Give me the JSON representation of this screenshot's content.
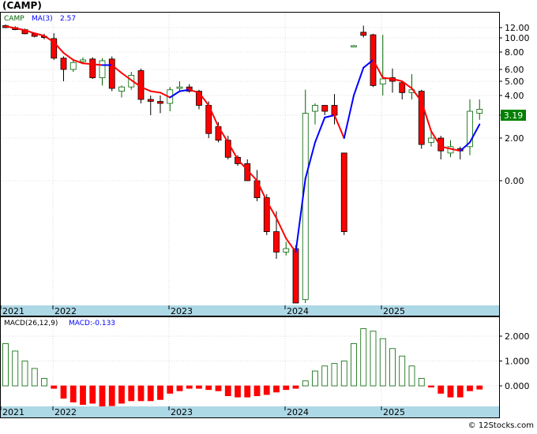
{
  "ticker": "(CAMP)",
  "watermark": "© 12Stocks.com",
  "colors": {
    "up": "#006400",
    "down": "#ff0000",
    "ma": "#0000ff",
    "axis_band": "#add8e6",
    "grid": "#c0c0c0",
    "last_price_box": "#008000"
  },
  "price_panel": {
    "legend_symbol": "CAMP",
    "ma_label": "MA(3)",
    "ma_value": "2.57",
    "last_price": "3.19",
    "y_ticks": [
      "12.00",
      "10.00",
      "8.00",
      "6.00",
      "5.00",
      "4.00",
      "3.00",
      "2.00",
      "0.00"
    ]
  },
  "macd_panel": {
    "label": "MACD(26,12,9)",
    "value_label": "MACD:-0.133",
    "y_ticks": [
      "2.000",
      "1.000",
      "0.000"
    ]
  },
  "x_axis": {
    "labels": [
      "2021",
      "2022",
      "2023",
      "2024",
      "2025"
    ]
  },
  "chart_data": [
    {
      "type": "candlestick",
      "title": "(CAMP)",
      "legend": [
        "CAMP",
        "MA(3) 2.57"
      ],
      "ylabels": [
        "12.00",
        "10.00",
        "8.00",
        "6.00",
        "5.00",
        "4.00",
        "3.00",
        "2.00",
        "0.00"
      ],
      "last_price": 3.19,
      "candles": [
        {
          "o": 12.3,
          "h": 12.5,
          "l": 11.9,
          "c": 12.0
        },
        {
          "o": 12.0,
          "h": 12.2,
          "l": 11.5,
          "c": 11.6
        },
        {
          "o": 11.6,
          "h": 11.8,
          "l": 10.7,
          "c": 10.8
        },
        {
          "o": 10.8,
          "h": 11.0,
          "l": 10.1,
          "c": 10.3
        },
        {
          "o": 10.3,
          "h": 10.8,
          "l": 9.8,
          "c": 10.1
        },
        {
          "o": 9.9,
          "h": 10.9,
          "l": 7.1,
          "c": 7.3
        },
        {
          "o": 7.3,
          "h": 7.5,
          "l": 5.0,
          "c": 6.0
        },
        {
          "o": 6.0,
          "h": 7.1,
          "l": 5.8,
          "c": 6.8
        },
        {
          "o": 6.9,
          "h": 7.4,
          "l": 6.7,
          "c": 7.1
        },
        {
          "o": 7.2,
          "h": 7.4,
          "l": 5.2,
          "c": 5.3
        },
        {
          "o": 5.3,
          "h": 7.3,
          "l": 4.7,
          "c": 7.0
        },
        {
          "o": 7.2,
          "h": 7.5,
          "l": 4.3,
          "c": 4.5
        },
        {
          "o": 4.3,
          "h": 4.7,
          "l": 3.9,
          "c": 4.6
        },
        {
          "o": 4.6,
          "h": 5.8,
          "l": 4.4,
          "c": 5.5
        },
        {
          "o": 5.9,
          "h": 6.1,
          "l": 3.6,
          "c": 3.8
        },
        {
          "o": 3.8,
          "h": 4.0,
          "l": 3.0,
          "c": 3.7
        },
        {
          "o": 3.7,
          "h": 4.0,
          "l": 3.1,
          "c": 3.6
        },
        {
          "o": 3.6,
          "h": 4.6,
          "l": 3.2,
          "c": 4.4
        },
        {
          "o": 4.5,
          "h": 5.0,
          "l": 4.3,
          "c": 4.6
        },
        {
          "o": 4.6,
          "h": 4.8,
          "l": 4.2,
          "c": 4.3
        },
        {
          "o": 4.3,
          "h": 4.4,
          "l": 3.3,
          "c": 3.5
        },
        {
          "o": 3.5,
          "h": 3.7,
          "l": 2.0,
          "c": 2.2
        },
        {
          "o": 2.5,
          "h": 2.7,
          "l": 1.8,
          "c": 1.9
        },
        {
          "o": 1.9,
          "h": 2.1,
          "l": 1.0,
          "c": 1.1
        },
        {
          "o": 1.1,
          "h": 1.2,
          "l": 0.7,
          "c": 0.8
        },
        {
          "o": 0.8,
          "h": 1.0,
          "l": 0.0,
          "c": 0.0
        },
        {
          "o": 0.0,
          "h": 0.5,
          "l": -0.6,
          "c": -0.5
        },
        {
          "o": -0.5,
          "h": -0.4,
          "l": -1.6,
          "c": -1.5
        },
        {
          "o": -1.5,
          "h": -0.9,
          "l": -2.3,
          "c": -2.1
        },
        {
          "o": -2.1,
          "h": -1.8,
          "l": -2.2,
          "c": -2.0
        },
        {
          "o": -2.0,
          "h": -1.9,
          "l": -3.6,
          "c": -3.6
        },
        {
          "o": -3.5,
          "h": 4.4,
          "l": -3.6,
          "c": 3.1
        },
        {
          "o": 3.2,
          "h": 3.6,
          "l": 2.6,
          "c": 3.5
        },
        {
          "o": 3.5,
          "h": 3.5,
          "l": 3.0,
          "c": 3.2
        },
        {
          "o": 3.5,
          "h": 4.1,
          "l": 2.6,
          "c": 3.0
        },
        {
          "o": 1.3,
          "h": 1.3,
          "l": -1.6,
          "c": -1.5
        },
        {
          "o": 8.9,
          "h": 9.0,
          "l": 8.9,
          "c": 8.9
        },
        {
          "o": 11.1,
          "h": 12.3,
          "l": 10.1,
          "c": 10.5
        },
        {
          "o": 10.6,
          "h": 10.8,
          "l": 4.6,
          "c": 4.7
        },
        {
          "o": 4.8,
          "h": 10.6,
          "l": 4.0,
          "c": 5.2
        },
        {
          "o": 5.3,
          "h": 6.1,
          "l": 4.2,
          "c": 5.0
        },
        {
          "o": 4.9,
          "h": 5.0,
          "l": 3.8,
          "c": 4.2
        },
        {
          "o": 4.2,
          "h": 5.6,
          "l": 3.8,
          "c": 4.4
        },
        {
          "o": 4.3,
          "h": 4.4,
          "l": 1.5,
          "c": 1.7
        },
        {
          "o": 1.8,
          "h": 2.3,
          "l": 1.6,
          "c": 2.0
        },
        {
          "o": 2.0,
          "h": 2.1,
          "l": 1.0,
          "c": 1.4
        },
        {
          "o": 1.3,
          "h": 1.9,
          "l": 1.1,
          "c": 1.6
        },
        {
          "o": 1.5,
          "h": 1.6,
          "l": 1.0,
          "c": 1.4
        },
        {
          "o": 1.6,
          "h": 3.8,
          "l": 1.2,
          "c": 3.2
        },
        {
          "o": 3.1,
          "h": 3.8,
          "l": 2.8,
          "c": 3.3
        }
      ],
      "ma": [
        12.2,
        11.9,
        11.5,
        10.9,
        10.4,
        9.4,
        7.9,
        7.1,
        6.7,
        6.6,
        6.5,
        6.5,
        5.7,
        5.1,
        4.6,
        4.3,
        4.2,
        3.9,
        4.3,
        4.4,
        4.2,
        3.5,
        2.5,
        1.8,
        1.0,
        0.5,
        0.0,
        -0.6,
        -1.1,
        -1.7,
        -2.1,
        0.1,
        1.8,
        2.9,
        3.0,
        2.0,
        4.0,
        6.2,
        7.1,
        5.3,
        5.2,
        5.0,
        4.5,
        3.7,
        2.3,
        1.6,
        1.5,
        1.4,
        1.8,
        2.6
      ]
    },
    {
      "type": "bar",
      "title": "MACD(26,12,9)",
      "legend": [
        "MACD:-0.133"
      ],
      "ylabels": [
        "2.000",
        "1.000",
        "0.000"
      ],
      "values": [
        1.7,
        1.4,
        1.0,
        0.7,
        0.3,
        -0.1,
        -0.5,
        -0.65,
        -0.75,
        -0.7,
        -0.85,
        -0.8,
        -0.7,
        -0.6,
        -0.6,
        -0.6,
        -0.55,
        -0.3,
        -0.2,
        -0.1,
        -0.1,
        -0.15,
        -0.2,
        -0.4,
        -0.45,
        -0.45,
        -0.4,
        -0.35,
        -0.25,
        -0.15,
        -0.1,
        0.2,
        0.6,
        0.8,
        0.9,
        1.0,
        1.7,
        2.3,
        2.2,
        1.9,
        1.5,
        1.2,
        0.8,
        0.3,
        -0.05,
        -0.3,
        -0.45,
        -0.45,
        -0.2,
        -0.133
      ]
    }
  ]
}
